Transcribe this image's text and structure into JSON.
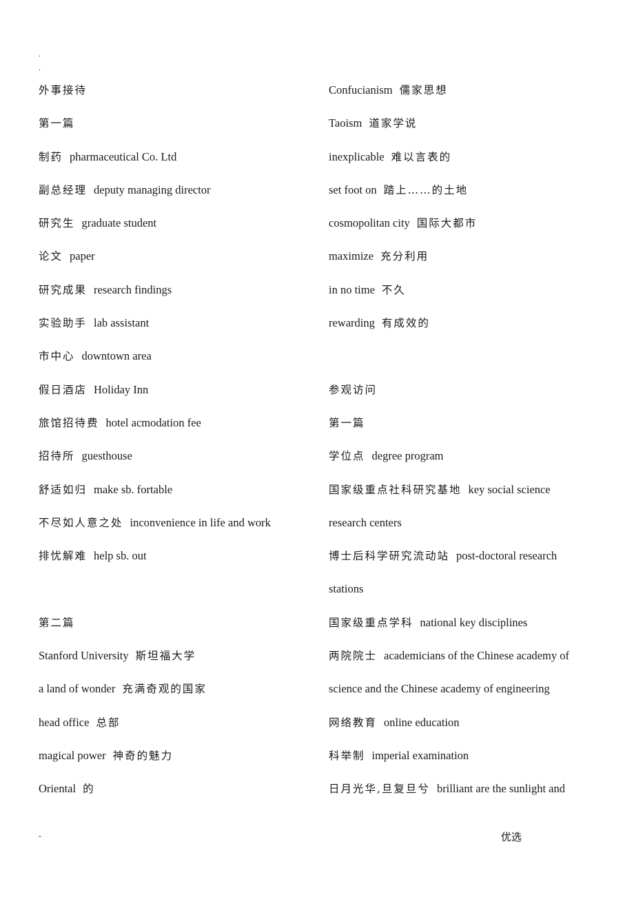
{
  "header_marks": [
    ".",
    "."
  ],
  "left_column": [
    {
      "text": "外事接待",
      "type": "heading"
    },
    {
      "text": "第一篇",
      "type": "heading"
    },
    {
      "zh": "制药",
      "en": "pharmaceutical Co. Ltd"
    },
    {
      "zh": "副总经理",
      "en": "deputy managing director"
    },
    {
      "zh": "研究生",
      "en": "graduate student"
    },
    {
      "zh": "论文",
      "en": "paper"
    },
    {
      "zh": "研究成果",
      "en": "research findings"
    },
    {
      "zh": "实验助手",
      "en": "lab assistant"
    },
    {
      "zh": "市中心",
      "en": "downtown area"
    },
    {
      "zh": "假日酒店",
      "en": "Holiday Inn"
    },
    {
      "zh": "旅馆招待费",
      "en": "hotel acmodation fee"
    },
    {
      "zh": "招待所",
      "en": "guesthouse"
    },
    {
      "zh": "舒适如归",
      "en": "make sb. fortable"
    },
    {
      "zh": "不尽如人意之处",
      "en": "inconvenience in life and work"
    },
    {
      "zh": "排忧解难",
      "en": "help sb. out"
    },
    {
      "type": "blank"
    },
    {
      "text": "第二篇",
      "type": "heading"
    },
    {
      "en": "Stanford University",
      "zh": "斯坦福大学",
      "order": "en-zh"
    },
    {
      "en": "a land of wonder",
      "zh": "充满奇观的国家",
      "order": "en-zh"
    },
    {
      "en": "head office",
      "zh": "总部",
      "order": "en-zh"
    },
    {
      "en": "magical power",
      "zh": "神奇的魅力",
      "order": "en-zh"
    },
    {
      "en": "Oriental",
      "zh": "的",
      "order": "en-zh"
    }
  ],
  "right_column": [
    {
      "en": "Confucianism",
      "zh": "儒家思想",
      "order": "en-zh"
    },
    {
      "en": "Taoism",
      "zh": "道家学说",
      "order": "en-zh"
    },
    {
      "en": "inexplicable",
      "zh": "难以言表的",
      "order": "en-zh"
    },
    {
      "en": "set foot on",
      "zh": "踏上……的土地",
      "order": "en-zh"
    },
    {
      "en": "cosmopolitan city",
      "zh": "国际大都市",
      "order": "en-zh"
    },
    {
      "en": "maximize",
      "zh": "充分利用",
      "order": "en-zh"
    },
    {
      "en": "in no time",
      "zh": "不久",
      "order": "en-zh"
    },
    {
      "en": "rewarding",
      "zh": "有成效的",
      "order": "en-zh"
    },
    {
      "type": "blank"
    },
    {
      "text": "参观访问",
      "type": "heading"
    },
    {
      "text": "第一篇",
      "type": "heading"
    },
    {
      "zh": "学位点",
      "en": "degree program"
    },
    {
      "zh": "国家级重点社科研究基地",
      "en": "key social science"
    },
    {
      "text": "research centers",
      "type": "continuation"
    },
    {
      "zh": "博士后科学研究流动站",
      "en": "post-doctoral research"
    },
    {
      "text": "stations",
      "type": "continuation"
    },
    {
      "zh": "国家级重点学科",
      "en": "national key disciplines"
    },
    {
      "zh": "两院院士",
      "en": "academicians of the Chinese academy of"
    },
    {
      "text": "science and the Chinese academy of engineering",
      "type": "continuation"
    },
    {
      "zh": "网络教育",
      "en": "online education"
    },
    {
      "zh": "科举制",
      "en": "imperial examination"
    },
    {
      "zh": "日月光华,旦复旦兮",
      "en": "brilliant are the sunlight and"
    }
  ],
  "footer": {
    "left": "-",
    "right": "优选"
  }
}
